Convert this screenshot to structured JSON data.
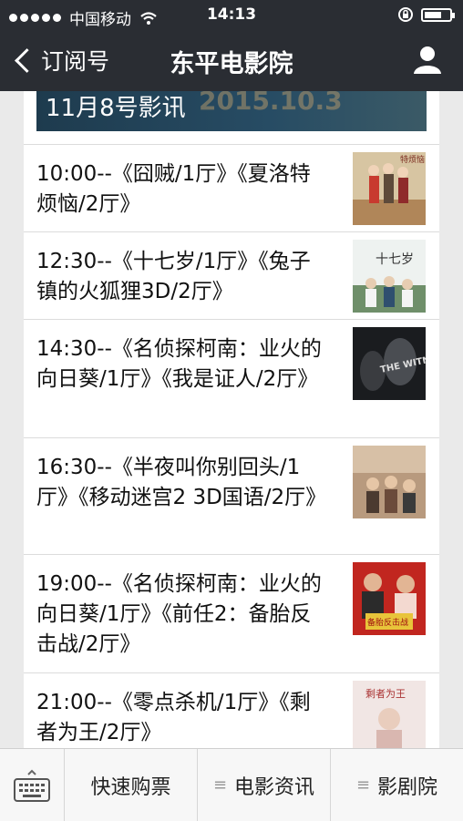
{
  "status": {
    "carrier": "中国移动",
    "time": "14:13"
  },
  "nav": {
    "back_label": "订阅号",
    "title": "东平电影院"
  },
  "banner": {
    "title": "11月8号影讯",
    "watermark": "2015.10.3"
  },
  "schedule": [
    {
      "text": "10:00--《囧贼/1厅》《夏洛特烦恼/2厅》"
    },
    {
      "text": "12:30--《十七岁/1厅》《兔子镇的火狐狸3D/2厅》"
    },
    {
      "text": "14:30--《名侦探柯南：业火的向日葵/1厅》《我是证人/2厅》"
    },
    {
      "text": "16:30--《半夜叫你别回头/1厅》《移动迷宫2 3D国语/2厅》"
    },
    {
      "text": "19:00--《名侦探柯南：业火的向日葵/1厅》《前任2：备胎反击战/2厅》"
    },
    {
      "text": "21:00--《零点杀机/1厅》《剩者为王/2厅》"
    }
  ],
  "posters": {
    "p1": "特烦恼",
    "p2": "十七岁",
    "p3": "THE WITNESS",
    "p5": "备胎反击战",
    "p6": "剩者为王"
  },
  "tabs": {
    "quick": "快速购票",
    "news": "电影资讯",
    "theater": "影剧院",
    "menu_glyph": "≡"
  },
  "colors": {
    "bar": "#2a2d33",
    "page_bg": "#eaeaea",
    "card": "#ffffff"
  }
}
